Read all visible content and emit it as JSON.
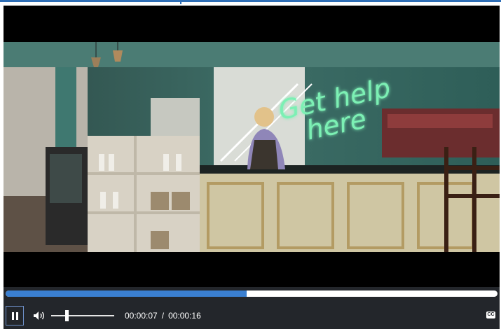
{
  "video": {
    "neon_text_line1": "Get help",
    "neon_text_line2": "here",
    "scene": "cafe-counter",
    "progress_fraction": 0.49
  },
  "controls": {
    "play_state_icon": "pause-icon",
    "volume_icon": "speaker-icon",
    "volume_fraction": 0.22,
    "current_time": "00:00:07",
    "separator": "/",
    "duration": "00:00:16",
    "cc_icon": "closed-captions-icon",
    "cc_label": "CC"
  },
  "colors": {
    "progress": "#3a7fd1",
    "controls_bg": "#23262b",
    "accent": "#2f6fb7",
    "neon": "#7cf0b4"
  }
}
